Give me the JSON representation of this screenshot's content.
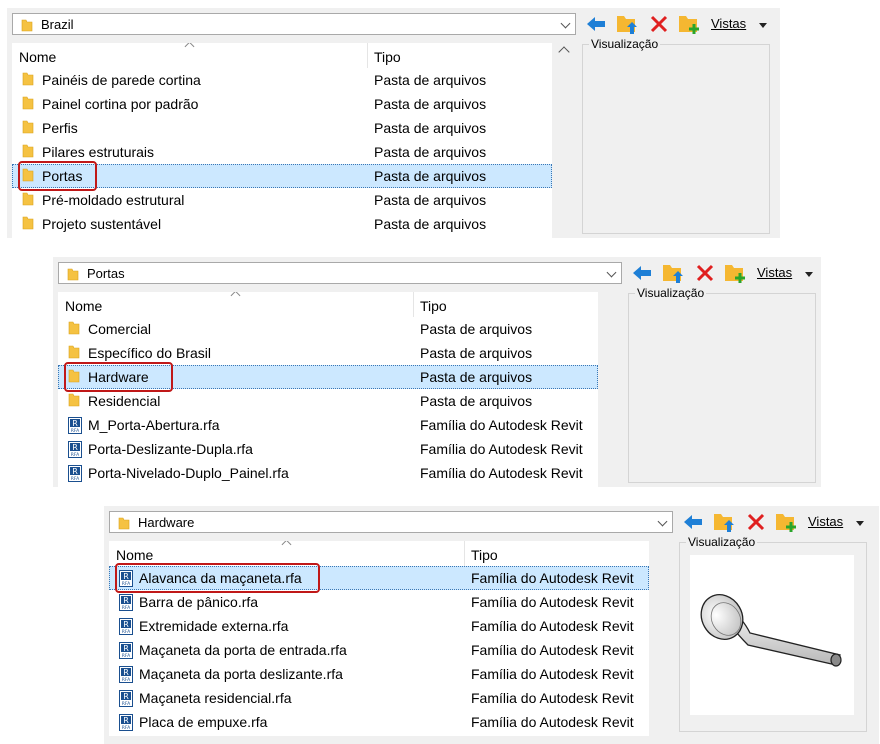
{
  "panel1": {
    "path": "Brazil",
    "headers": {
      "name": "Nome",
      "type": "Tipo"
    },
    "toolbar": {
      "vistas": "Vistas"
    },
    "preview_label": "Visualização",
    "rows": [
      {
        "name": "Painéis de parede cortina",
        "type": "Pasta de arquivos",
        "icon": "folder-icon"
      },
      {
        "name": "Painel cortina por padrão",
        "type": "Pasta de arquivos",
        "icon": "folder-icon"
      },
      {
        "name": "Perfis",
        "type": "Pasta de arquivos",
        "icon": "folder-icon"
      },
      {
        "name": "Pilares estruturais",
        "type": "Pasta de arquivos",
        "icon": "folder-icon"
      },
      {
        "name": "Portas",
        "type": "Pasta de arquivos",
        "icon": "folder-icon",
        "selected": true
      },
      {
        "name": "Pré-moldado estrutural",
        "type": "Pasta de arquivos",
        "icon": "folder-icon"
      },
      {
        "name": "Projeto sustentável",
        "type": "Pasta de arquivos",
        "icon": "folder-icon"
      }
    ]
  },
  "panel2": {
    "path": "Portas",
    "headers": {
      "name": "Nome",
      "type": "Tipo"
    },
    "toolbar": {
      "vistas": "Vistas"
    },
    "preview_label": "Visualização",
    "rows": [
      {
        "name": "Comercial",
        "type": "Pasta de arquivos",
        "icon": "folder-icon"
      },
      {
        "name": "Específico do Brasil",
        "type": "Pasta de arquivos",
        "icon": "folder-icon"
      },
      {
        "name": "Hardware",
        "type": "Pasta de arquivos",
        "icon": "folder-icon",
        "selected": true
      },
      {
        "name": "Residencial",
        "type": "Pasta de arquivos",
        "icon": "folder-icon"
      },
      {
        "name": "M_Porta-Abertura.rfa",
        "type": "Família do Autodesk Revit",
        "icon": "revit-family-icon"
      },
      {
        "name": "Porta-Deslizante-Dupla.rfa",
        "type": "Família do Autodesk Revit",
        "icon": "revit-family-icon"
      },
      {
        "name": "Porta-Nivelado-Duplo_Painel.rfa",
        "type": "Família do Autodesk Revit",
        "icon": "revit-family-icon"
      }
    ]
  },
  "panel3": {
    "path": "Hardware",
    "headers": {
      "name": "Nome",
      "type": "Tipo"
    },
    "toolbar": {
      "vistas": "Vistas"
    },
    "preview_label": "Visualização",
    "rows": [
      {
        "name": "Alavanca da maçaneta.rfa",
        "type": "Família do Autodesk Revit",
        "icon": "revit-family-icon",
        "selected": true
      },
      {
        "name": "Barra de pânico.rfa",
        "type": "Família do Autodesk Revit",
        "icon": "revit-family-icon"
      },
      {
        "name": "Extremidade externa.rfa",
        "type": "Família do Autodesk Revit",
        "icon": "revit-family-icon"
      },
      {
        "name": "Maçaneta da porta de entrada.rfa",
        "type": "Família do Autodesk Revit",
        "icon": "revit-family-icon"
      },
      {
        "name": "Maçaneta da porta deslizante.rfa",
        "type": "Família do Autodesk Revit",
        "icon": "revit-family-icon"
      },
      {
        "name": "Maçaneta residencial.rfa",
        "type": "Família do Autodesk Revit",
        "icon": "revit-family-icon"
      },
      {
        "name": "Placa de empuxe.rfa",
        "type": "Família do Autodesk Revit",
        "icon": "revit-family-icon"
      }
    ]
  },
  "colors": {
    "selection": "#cce8ff",
    "highlight_box": "#c01818",
    "folder": "#f5c242",
    "back_arrow": "#1e7fd6",
    "delete": "#e02020",
    "new_folder_plus": "#2aa52a"
  }
}
